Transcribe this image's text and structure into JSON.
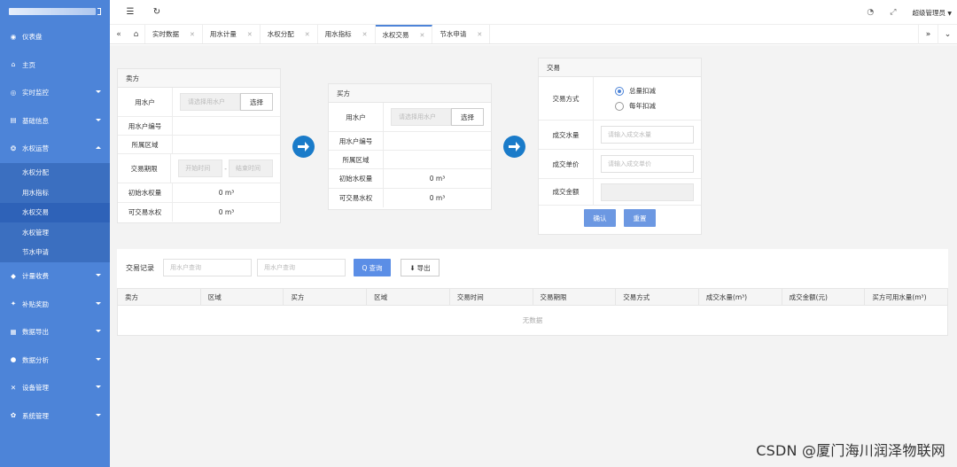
{
  "sidebar": {
    "items": [
      {
        "label": "仪表盘",
        "icon": "dashboard-icon",
        "glyph": "◉"
      },
      {
        "label": "主页",
        "icon": "home-icon",
        "glyph": "⌂"
      },
      {
        "label": "实时监控",
        "icon": "monitor-icon",
        "glyph": "◎",
        "arrow": true
      },
      {
        "label": "基础信息",
        "icon": "info-icon",
        "glyph": "▤",
        "arrow": true
      },
      {
        "label": "水权运营",
        "icon": "water-icon",
        "glyph": "❂",
        "arrow": "up",
        "open": true
      },
      {
        "label": "计量收费",
        "icon": "billing-icon",
        "glyph": "◆",
        "arrow": true
      },
      {
        "label": "补贴奖励",
        "icon": "reward-icon",
        "glyph": "✦",
        "arrow": true
      },
      {
        "label": "数据导出",
        "icon": "export-icon",
        "glyph": "▦",
        "arrow": true
      },
      {
        "label": "数据分析",
        "icon": "analysis-icon",
        "glyph": "●",
        "arrow": true
      },
      {
        "label": "设备管理",
        "icon": "device-icon",
        "glyph": "✕",
        "arrow": true
      },
      {
        "label": "系统管理",
        "icon": "settings-icon",
        "glyph": "✿",
        "arrow": true
      }
    ],
    "submenu": [
      {
        "label": "水权分配"
      },
      {
        "label": "用水指标"
      },
      {
        "label": "水权交易",
        "active": true
      },
      {
        "label": "水权管理"
      },
      {
        "label": "节水申请"
      }
    ]
  },
  "topbar": {
    "user": "超级管理员"
  },
  "tabs": [
    {
      "label": "实时数据"
    },
    {
      "label": "用水计量"
    },
    {
      "label": "水权分配"
    },
    {
      "label": "用水指标"
    },
    {
      "label": "水权交易",
      "active": true
    },
    {
      "label": "节水申请"
    }
  ],
  "seller": {
    "title": "卖方",
    "user_label": "用水户",
    "user_placeholder": "请选择用水户",
    "select_btn": "选择",
    "code_label": "用水户编号",
    "region_label": "所属区域",
    "period_label": "交易期限",
    "start_placeholder": "开始时间",
    "end_placeholder": "结束时间",
    "period_sep": "-",
    "init_label": "初始水权量",
    "init_value": "0 m³",
    "tradable_label": "可交易水权",
    "tradable_value": "0 m³"
  },
  "buyer": {
    "title": "买方",
    "user_label": "用水户",
    "user_placeholder": "请选择用水户",
    "select_btn": "选择",
    "code_label": "用水户编号",
    "region_label": "所属区域",
    "init_label": "初始水权量",
    "init_value": "0 m³",
    "tradable_label": "可交易水权",
    "tradable_value": "0 m³"
  },
  "trade": {
    "title": "交易",
    "mode_label": "交易方式",
    "mode_opt1": "总量扣减",
    "mode_opt2": "每年扣减",
    "volume_label": "成交水量",
    "volume_placeholder": "请输入成交水量",
    "price_label": "成交单价",
    "price_placeholder": "请输入成交单价",
    "amount_label": "成交金额",
    "confirm": "确认",
    "reset": "重置"
  },
  "records": {
    "label": "交易记录",
    "search1_placeholder": "用水户查询",
    "search2_placeholder": "用水户查询",
    "query": "查询",
    "export": "导出",
    "columns": [
      "卖方",
      "区域",
      "买方",
      "区域",
      "交易时间",
      "交易期限",
      "交易方式",
      "成交水量(m³)",
      "成交金额(元)",
      "买方可用水量(m³)"
    ],
    "empty": "无数据"
  },
  "watermark": "CSDN @厦门海川润泽物联网"
}
